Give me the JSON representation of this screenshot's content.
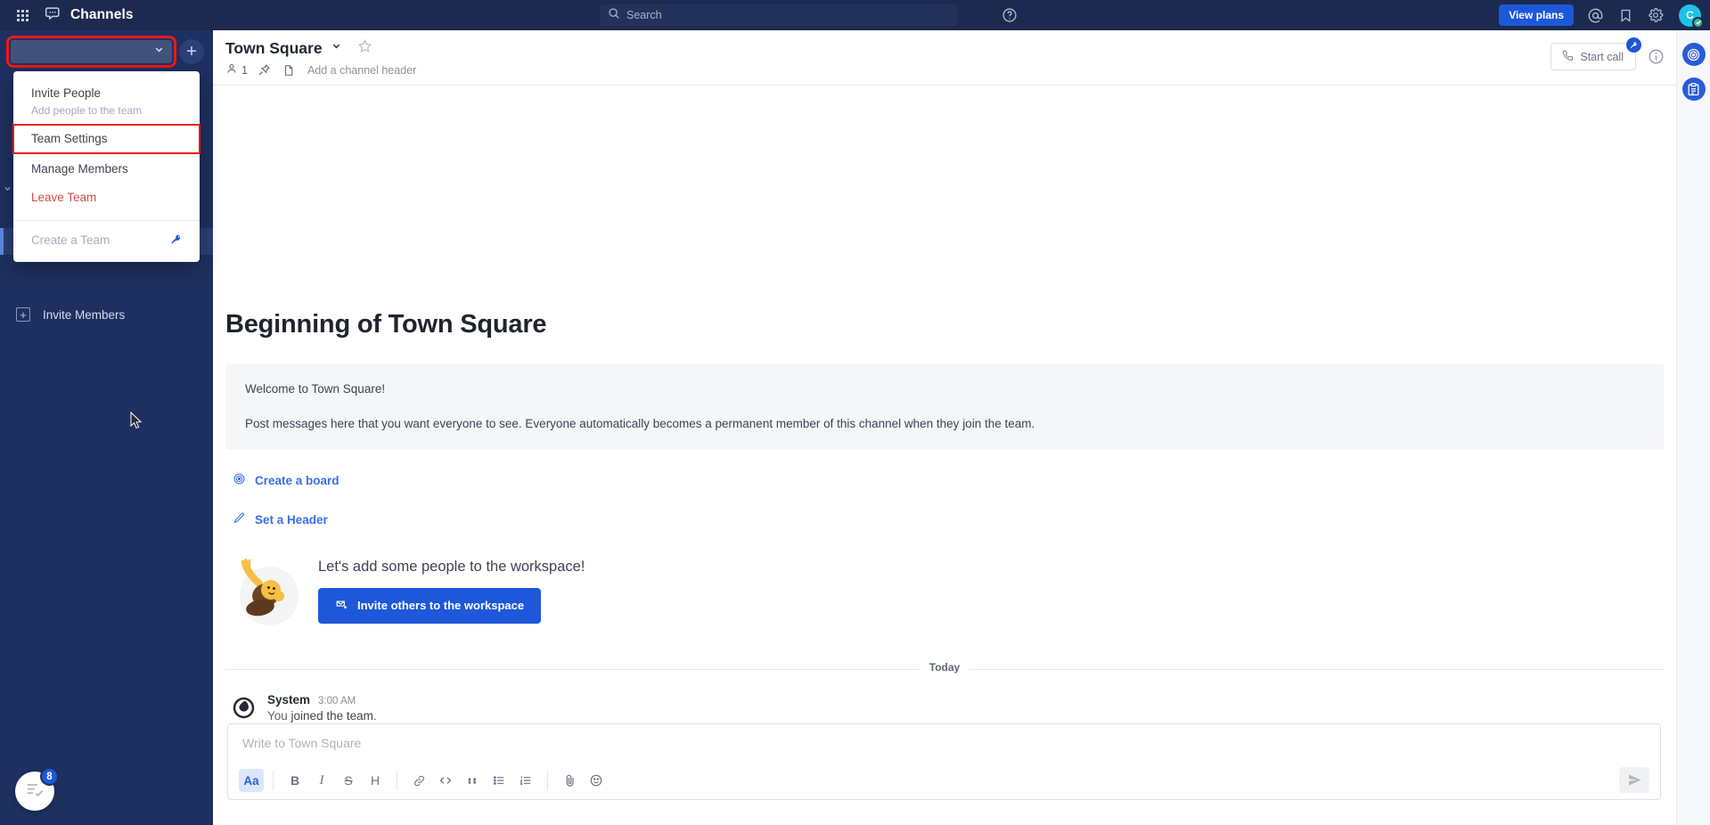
{
  "global_header": {
    "product_name": "Channels",
    "grid_icon": "apps-grid-icon",
    "product_icon": "channels-icon",
    "search": {
      "placeholder": "Search",
      "icon": "search-icon"
    },
    "help_icon": "help-circle-icon",
    "view_plans_label": "View plans",
    "mention_icon": "at-mention-icon",
    "saved_icon": "bookmark-flag-icon",
    "settings_icon": "gear-icon",
    "avatar_initial": "C",
    "status": "online",
    "bg_color": "#1b2a4e",
    "accent_color": "#1c58d9"
  },
  "sidebar": {
    "team_name": "",
    "team_chevron_icon": "chevron-down-icon",
    "add_channel_icon": "plus-icon",
    "invite_members_label": "Invite Members",
    "invite_members_icon": "plus-square-icon",
    "onboarding_badge": "8",
    "onboarding_icon": "checklist-icon",
    "bg_color": "#1e3060"
  },
  "team_menu": {
    "items": [
      {
        "label": "Invite People",
        "sub": "Add people to the team",
        "style": "normal",
        "highlighted": false
      },
      {
        "label": "Team Settings",
        "sub": "",
        "style": "normal",
        "highlighted": true
      },
      {
        "label": "Manage Members",
        "sub": "",
        "style": "normal",
        "highlighted": false
      },
      {
        "label": "Leave Team",
        "sub": "",
        "style": "danger",
        "highlighted": false
      }
    ],
    "create_team_label": "Create a Team",
    "create_team_badge_icon": "key-icon",
    "highlight_color": "#f01818"
  },
  "channel_header": {
    "title": "Town Square",
    "chevron_icon": "chevron-down-icon",
    "favorite_icon": "star-outline-icon",
    "members_icon": "member-icon",
    "members_count": "1",
    "pin_icon": "pin-icon",
    "file_icon": "file-icon",
    "header_placeholder": "Add a channel header",
    "start_call_label": "Start call",
    "start_call_icon": "phone-icon",
    "start_call_badge_icon": "key-icon",
    "info_icon": "info-circle-icon"
  },
  "app_rail": {
    "items": [
      {
        "icon": "playbooks-target-icon",
        "name": "playbooks"
      },
      {
        "icon": "boards-clipboard-icon",
        "name": "boards"
      }
    ]
  },
  "main": {
    "intro_title": "Beginning of Town Square",
    "welcome_line1": "Welcome to Town Square!",
    "welcome_line2": "Post messages here that you want everyone to see. Everyone automatically becomes a permanent member of this channel when they join the team.",
    "create_board_label": "Create a board",
    "create_board_icon": "target-icon",
    "set_header_label": "Set a Header",
    "set_header_icon": "pencil-icon",
    "invite_heading": "Let's add some people to the workspace!",
    "invite_button_label": "Invite others to the workspace",
    "invite_button_icon": "mail-plus-icon",
    "date_separator": "Today",
    "post": {
      "author": "System",
      "time": "3:00 AM",
      "avatar_icon": "mattermost-logo-icon",
      "text_prefix": "You ",
      "text_bold": "joined the team",
      "text_suffix": "."
    }
  },
  "composer": {
    "placeholder": "Write to Town Square",
    "send_icon": "send-icon",
    "toolbar": [
      {
        "label": "Aa",
        "name": "formatting-toggle",
        "active": true
      },
      {
        "label": "B",
        "name": "bold-button",
        "active": false
      },
      {
        "label": "I",
        "name": "italic-button",
        "active": false
      },
      {
        "label": "S",
        "name": "strikethrough-button",
        "active": false
      },
      {
        "label": "H",
        "name": "heading-button",
        "active": false
      },
      {
        "label": "link",
        "name": "link-button",
        "active": false
      },
      {
        "label": "code",
        "name": "code-button",
        "active": false
      },
      {
        "label": "quote",
        "name": "quote-button",
        "active": false
      },
      {
        "label": "ul",
        "name": "bulleted-list-button",
        "active": false
      },
      {
        "label": "ol",
        "name": "numbered-list-button",
        "active": false
      },
      {
        "label": "attach",
        "name": "attachment-button",
        "active": false
      },
      {
        "label": "emoji",
        "name": "emoji-button",
        "active": false
      }
    ]
  }
}
